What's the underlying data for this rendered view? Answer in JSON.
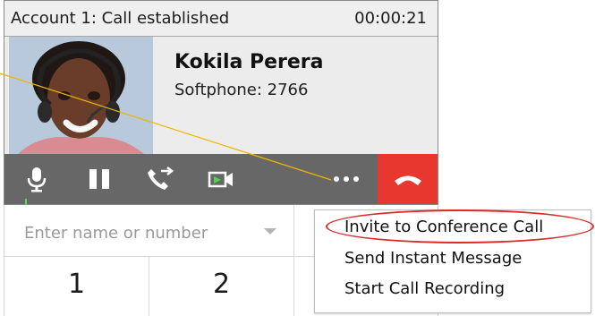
{
  "call_panel": {
    "title": "Account 1: Call established",
    "timer": "00:00:21"
  },
  "contact": {
    "name": "Kokila Perera",
    "detail": "Softphone: 2766",
    "avatar_icon": "person-headset-photo"
  },
  "toolbar": {
    "buttons": [
      {
        "icon": "microphone-icon"
      },
      {
        "icon": "pause-icon"
      },
      {
        "icon": "transfer-call-icon"
      },
      {
        "icon": "video-call-icon"
      },
      {
        "icon": "more-options-icon"
      },
      {
        "icon": "hang-up-icon"
      }
    ]
  },
  "dialer": {
    "search": {
      "placeholder": "Enter name or number",
      "value": ""
    },
    "keys": [
      "1",
      "2"
    ]
  },
  "menu": {
    "items": [
      "Invite to Conference Call",
      "Send Instant Message",
      "Start Call Recording"
    ]
  },
  "colors": {
    "toolbar": "#676767",
    "hangup": "#e7372f",
    "highlight": "#db2b2b",
    "connector": "#f0b400"
  }
}
